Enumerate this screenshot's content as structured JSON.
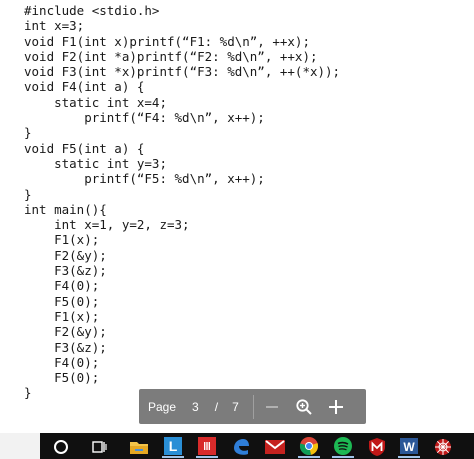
{
  "code_lines": [
    "#include <stdio.h>",
    "int x=3;",
    "void F1(int x)printf(“F1: %d\\n”, ++x);",
    "void F2(int *a)printf(“F2: %d\\n”, ++x);",
    "void F3(int *x)printf(“F3: %d\\n”, ++(*x));",
    "void F4(int a) {",
    "    static int x=4;",
    "        printf(“F4: %d\\n”, x++);",
    "}",
    "void F5(int a) {",
    "    static int y=3;",
    "        printf(“F5: %d\\n”, x++);",
    "}",
    "int main(){",
    "    int x=1, y=2, z=3;",
    "    F1(x);",
    "    F2(&y);",
    "    F3(&z);",
    "    F4(0);",
    "    F5(0);",
    "    F1(x);",
    "    F2(&y);",
    "    F3(&z);",
    "    F4(0);",
    "    F5(0);",
    "}"
  ],
  "pager": {
    "label": "Page",
    "current": "3",
    "separator": "/",
    "total": "7",
    "zoom_out_icon": "minus-icon",
    "zoom_icon": "magnifier-icon",
    "zoom_in_icon": "plus-icon"
  },
  "taskbar": {
    "icons": [
      "search-icon",
      "task-view-icon",
      "file-explorer-icon",
      "app-l-icon",
      "app-red-icon",
      "edge-icon",
      "gmail-icon",
      "chrome-icon",
      "spotify-icon",
      "mcafee-icon",
      "word-icon",
      "spider-web-icon"
    ],
    "word_letter": "W",
    "l_letter": "L"
  },
  "colors": {
    "pager_bg": "#7c7c7c",
    "taskbar_bg": "#101010",
    "text": "#1a1a1a"
  }
}
